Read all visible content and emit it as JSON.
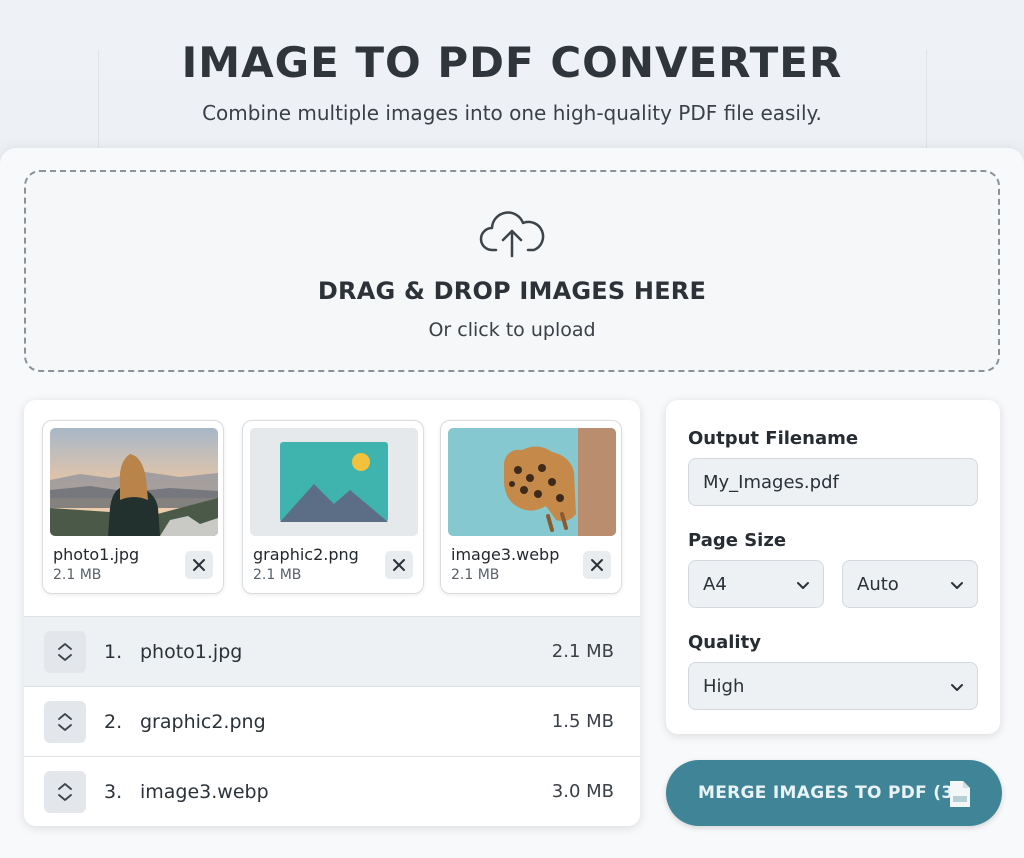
{
  "header": {
    "title": "IMAGE TO PDF CONVERTER",
    "subtitle": "Combine multiple images into one high-quality PDF file easily."
  },
  "dropzone": {
    "title": "DRAG & DROP IMAGES HERE",
    "subtitle": "Or click to upload",
    "icon": "cloud-upload-icon"
  },
  "thumbnails": [
    {
      "name": "photo1.jpg",
      "size": "2.1 MB"
    },
    {
      "name": "graphic2.png",
      "size": "2.1 MB"
    },
    {
      "name": "image3.webp",
      "size": "2.1 MB"
    }
  ],
  "file_list": [
    {
      "num": "1.",
      "name": "photo1.jpg",
      "size": "2.1 MB"
    },
    {
      "num": "2.",
      "name": "graphic2.png",
      "size": "1.5 MB"
    },
    {
      "num": "3.",
      "name": "image3.webp",
      "size": "3.0 MB"
    }
  ],
  "settings": {
    "filename_label": "Output Filename",
    "filename_value": "My_Images.pdf",
    "page_size_label": "Page Size",
    "page_size_value": "A4",
    "orientation_value": "Auto",
    "quality_label": "Quality",
    "quality_value": "High"
  },
  "merge_button": {
    "label": "MERGE IMAGES TO PDF (3)"
  },
  "colors": {
    "accent": "#3f8597",
    "background": "#eef1f5",
    "card": "#f8f9fb"
  }
}
